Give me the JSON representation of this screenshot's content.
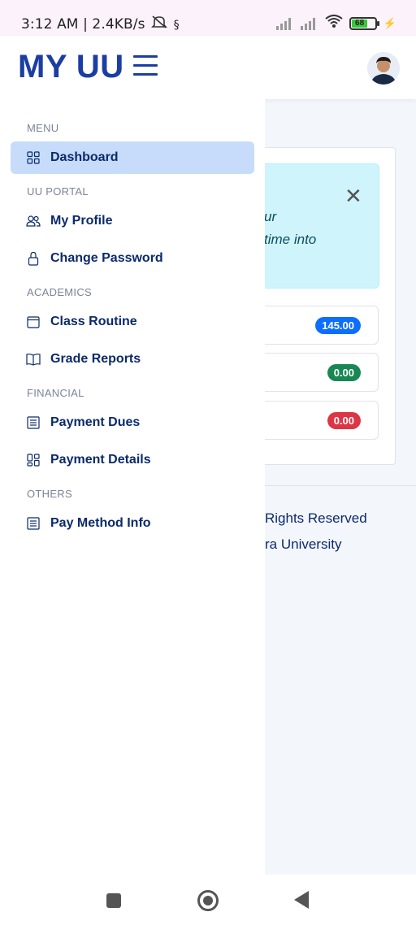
{
  "status": {
    "time_speed": "3:12 AM | 2.4KB/s",
    "battery": "68"
  },
  "header": {
    "logo": "MY UU"
  },
  "background": {
    "alert_text_line1": "ur",
    "alert_text_line2": "time into",
    "badges": [
      {
        "value": "145.00",
        "color": "#0d6efd"
      },
      {
        "value": "0.00",
        "color": "#198754"
      },
      {
        "value": "0.00",
        "color": "#dc3545"
      }
    ],
    "footer_line1": "Rights Reserved",
    "footer_line2": "ra University"
  },
  "drawer": {
    "sections": {
      "menu": "MENU",
      "portal": "UU PORTAL",
      "academics": "ACADEMICS",
      "financial": "FINANCIAL",
      "others": "OTHERS"
    },
    "items": {
      "dashboard": "Dashboard",
      "profile": "My Profile",
      "password": "Change Password",
      "routine": "Class Routine",
      "grades": "Grade Reports",
      "dues": "Payment Dues",
      "details": "Payment Details",
      "paymethod": "Pay Method Info"
    }
  },
  "colors": {
    "brand": "#1b3ea3",
    "active_bg": "#c6dcfa"
  }
}
